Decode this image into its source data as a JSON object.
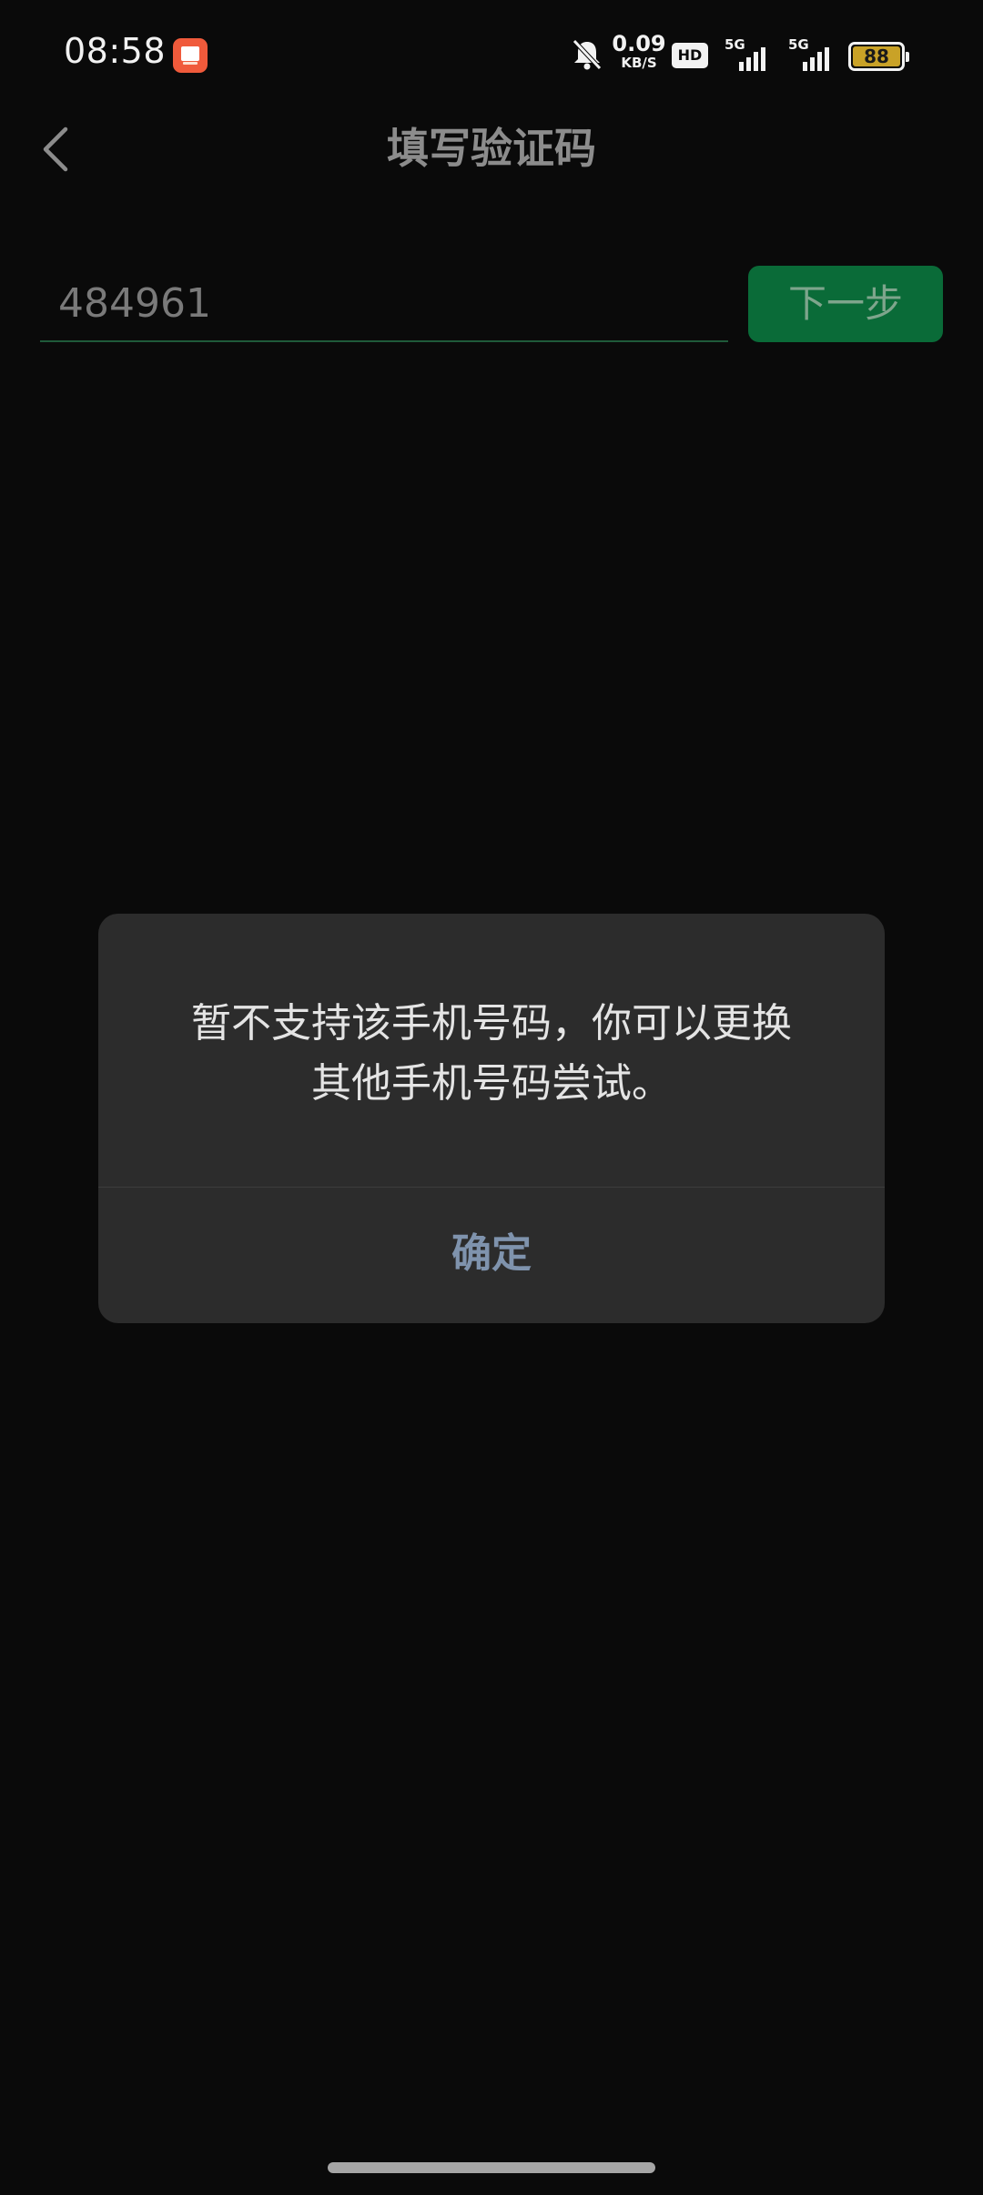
{
  "status_bar": {
    "time": "08:58",
    "net_speed_value": "0.09",
    "net_speed_unit": "KB/S",
    "hd_label": "HD",
    "signal_1_label": "5G",
    "signal_2_label": "5G",
    "battery_level": "88",
    "icons": [
      "app-notification-icon",
      "mute-bell-icon",
      "hd-icon",
      "signal-5g-icon",
      "signal-5g-icon",
      "battery-icon"
    ]
  },
  "header": {
    "title": "填写验证码",
    "back_icon": "chevron-left-icon"
  },
  "verify": {
    "code_value": "484961",
    "next_label": "下一步"
  },
  "dialog": {
    "message_line1": "暂不支持该手机号码，你可以更换",
    "message_line2": "其他手机号码尝试。",
    "confirm_label": "确定"
  },
  "colors": {
    "background": "#0a0a0a",
    "dialog_bg": "#2c2c2c",
    "accent_green": "#0a6b38",
    "confirm_text": "#7f93ad"
  }
}
